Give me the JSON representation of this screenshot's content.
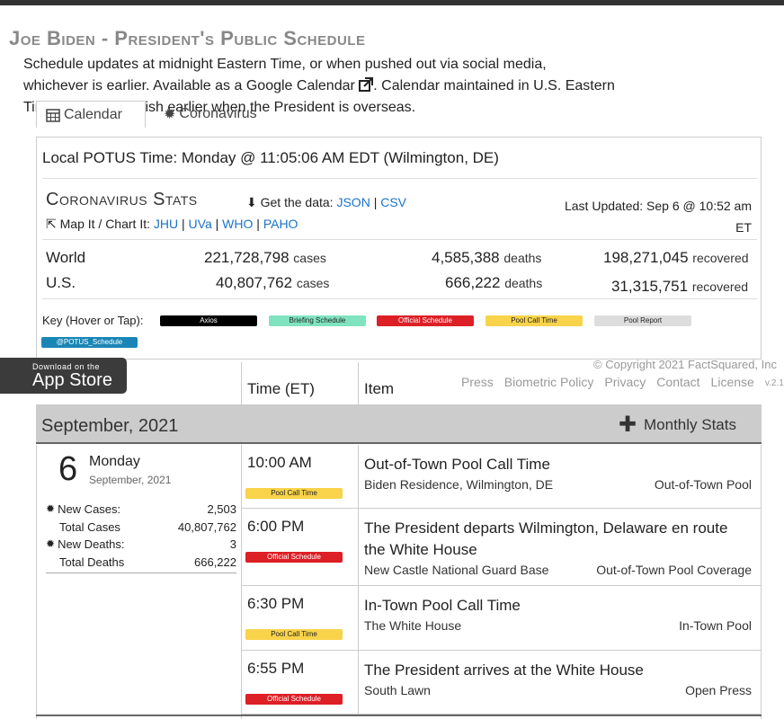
{
  "page": {
    "title": "Joe Biden - President's Public Schedule",
    "intro_line1": "Schedule updates at midnight Eastern Time, or when pushed out via social media,",
    "intro_line2_a": "whichever is earlier. Available as a ",
    "intro_link": "Google Calendar",
    "intro_line2_b": ". Calendar maintained in U.S. Eastern",
    "intro_line3": "Time and may publish earlier when the President is overseas."
  },
  "tabs": [
    {
      "label": "Calendar",
      "icon": "calendar-icon"
    },
    {
      "label": "Coronavirus",
      "icon": "virus-icon"
    }
  ],
  "potus_time": "Local POTUS Time: Monday @ 11:05:06 AM EDT (Wilmington, DE)",
  "stats": {
    "title": "Coronavirus Stats",
    "get_data_label": "Get the data: ",
    "json_link": "JSON",
    "sep": "|",
    "csv_link": "CSV",
    "last_updated": "Last Updated: Sep 6 @ 10:52 am ET",
    "map_label": "Map It / Chart It: ",
    "map_links": [
      "JHU",
      "UVa",
      "WHO",
      "PAHO"
    ],
    "rows": [
      {
        "region": "World",
        "cases": "221,728,798",
        "deaths": "4,585,388",
        "recovered": "198,271,045"
      },
      {
        "region": "U.S.",
        "cases": "40,807,762",
        "deaths": "666,222",
        "recovered": "31,315,751"
      }
    ],
    "unit_cases": "cases",
    "unit_deaths": "deaths",
    "unit_recovered": "recovered"
  },
  "key": {
    "label": "Key (Hover or Tap):",
    "items": [
      {
        "label": "Axios",
        "bg": "#000000",
        "fg": "#ffffff"
      },
      {
        "label": "Briefing Schedule",
        "bg": "#7fe3c0",
        "fg": "#222222"
      },
      {
        "label": "Official Schedule",
        "bg": "#dd1f26",
        "fg": "#ffffff"
      },
      {
        "label": "Pool Call Time",
        "bg": "#f9d34a",
        "fg": "#222222"
      },
      {
        "label": "Pool Report",
        "bg": "#dddddd",
        "fg": "#222222"
      },
      {
        "label": "@POTUS_Schedule",
        "bg": "#1a86b5",
        "fg": "#ffffff"
      }
    ]
  },
  "appstore": {
    "line1": "Download on the",
    "line2": "App Store"
  },
  "footer": {
    "copyright": "© Copyright 2021 FactSquared, Inc",
    "links": [
      "Press",
      "Biometric Policy",
      "Privacy",
      "Contact",
      "License"
    ],
    "version": "v.2.1"
  },
  "schedule": {
    "col_time": "Time (ET)",
    "col_item": "Item",
    "month": "September, 2021",
    "monthly_stats": "Monthly Stats",
    "day": {
      "num": "6",
      "name": "Monday",
      "date": "September, 2021",
      "new_cases_label": "New Cases:",
      "new_cases": "2,503",
      "total_cases_label": "Total Cases",
      "total_cases": "40,807,762",
      "new_deaths_label": "New Deaths:",
      "new_deaths": "3",
      "total_deaths_label": "Total Deaths",
      "total_deaths": "666,222"
    },
    "events": [
      {
        "time": "10:00 AM",
        "badge": "Pool Call Time",
        "badge_bg": "#f9d34a",
        "badge_fg": "#222222",
        "title": "Out-of-Town Pool Call Time",
        "location": "Biden Residence, Wilmington, DE",
        "pool": "Out-of-Town Pool"
      },
      {
        "time": "6:00 PM",
        "badge": "Official Schedule",
        "badge_bg": "#dd1f26",
        "badge_fg": "#ffffff",
        "title": "The President departs Wilmington, Delaware en route the White House",
        "location": "New Castle National Guard Base",
        "pool": "Out-of-Town Pool Coverage"
      },
      {
        "time": "6:30 PM",
        "badge": "Pool Call Time",
        "badge_bg": "#f9d34a",
        "badge_fg": "#222222",
        "title": "In-Town Pool Call Time",
        "location": "The White House",
        "pool": "In-Town Pool"
      },
      {
        "time": "6:55 PM",
        "badge": "Official Schedule",
        "badge_bg": "#dd1f26",
        "badge_fg": "#ffffff",
        "title": "The President arrives at the White House",
        "location": "South Lawn",
        "pool": "Open Press"
      }
    ]
  }
}
